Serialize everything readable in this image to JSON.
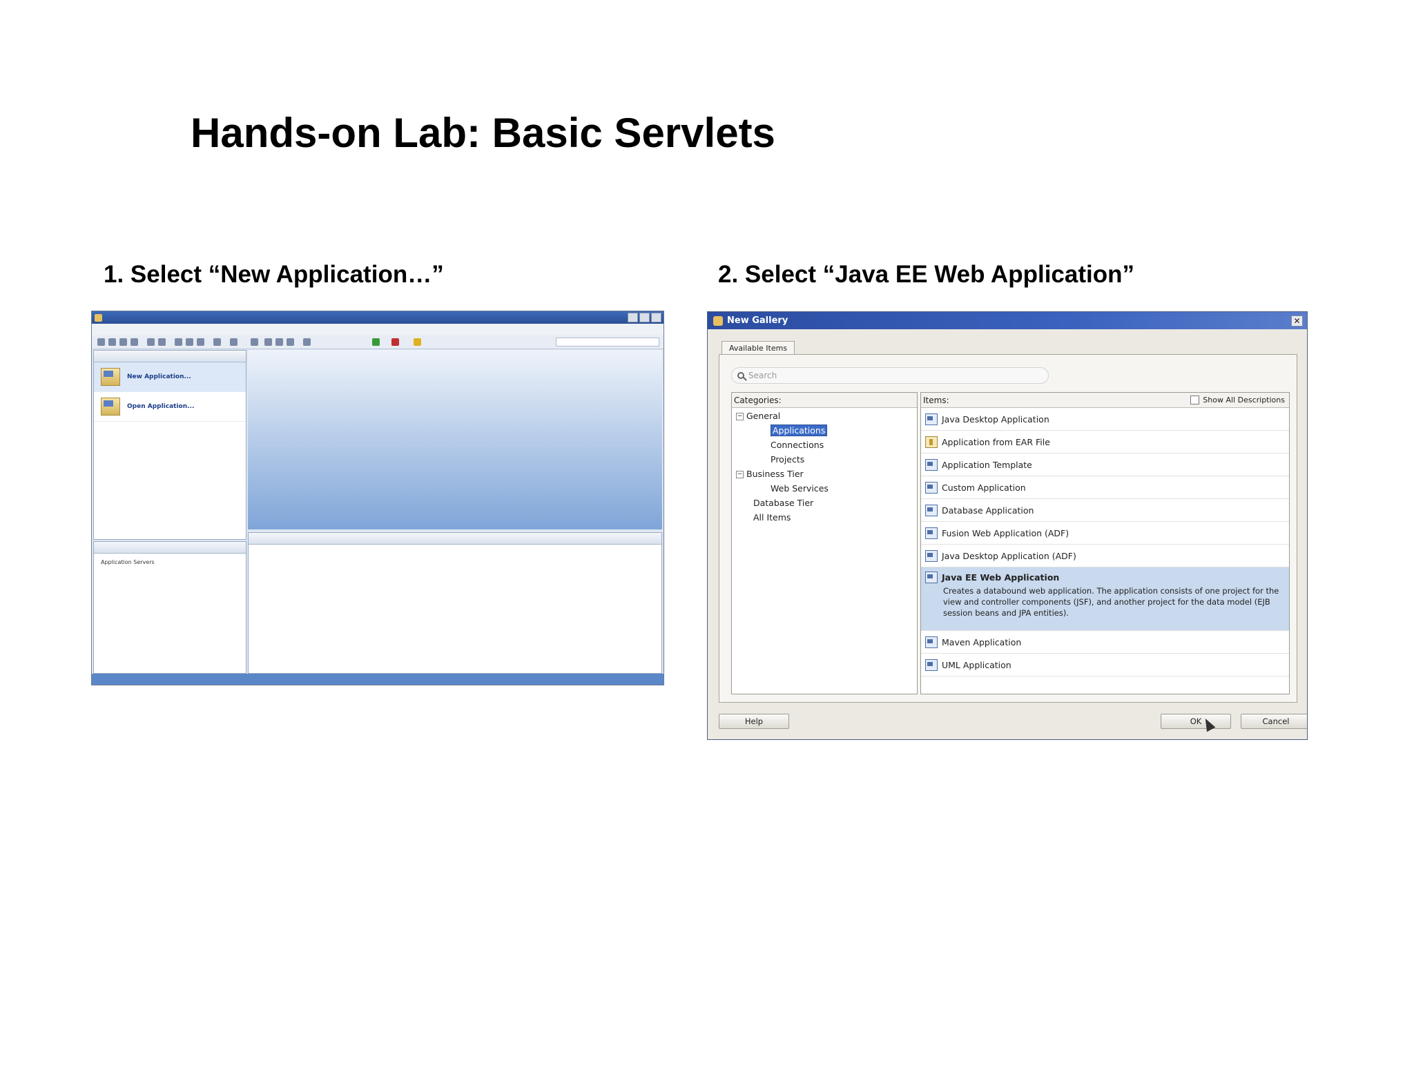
{
  "slide": {
    "title": "Hands-on Lab: Basic Servlets",
    "step1": "1. Select “New Application…”",
    "step2": "2. Select “Java EE Web Application”"
  },
  "ide": {
    "nav_items": [
      "New Application...",
      "Open Application..."
    ],
    "lower_tree": "Application Servers"
  },
  "gallery": {
    "title": "New Gallery",
    "tab": "Available Items",
    "search_placeholder": "Search",
    "categories_header": "Categories:",
    "items_header": "Items:",
    "show_all": "Show All Descriptions",
    "categories": [
      {
        "label": "General",
        "level": 0,
        "expander": "−"
      },
      {
        "label": "Applications",
        "level": 2,
        "selected": true
      },
      {
        "label": "Connections",
        "level": 2
      },
      {
        "label": "Projects",
        "level": 2
      },
      {
        "label": "Business Tier",
        "level": 0,
        "expander": "−"
      },
      {
        "label": "Web Services",
        "level": 2
      },
      {
        "label": "Database Tier",
        "level": 1
      },
      {
        "label": "All Items",
        "level": 1
      }
    ],
    "items": [
      {
        "label": "Java Desktop Application",
        "icon": "app-icon"
      },
      {
        "label": "Application from EAR File",
        "icon": "ear-file-icon"
      },
      {
        "label": "Application Template",
        "icon": "template-icon"
      },
      {
        "label": "Custom Application",
        "icon": "app-icon"
      },
      {
        "label": "Database Application",
        "icon": "app-icon"
      },
      {
        "label": "Fusion Web Application (ADF)",
        "icon": "app-icon"
      },
      {
        "label": "Java Desktop Application (ADF)",
        "icon": "app-icon"
      },
      {
        "label": "Java EE Web Application",
        "icon": "app-icon",
        "selected": true,
        "description": "Creates a databound web application. The application consists of one project for the view and controller components (JSF), and another project for the data model (EJB session beans and JPA entities)."
      },
      {
        "label": "Maven Application",
        "icon": "app-icon"
      },
      {
        "label": "UML Application",
        "icon": "app-icon"
      }
    ],
    "buttons": {
      "help": "Help",
      "ok": "OK",
      "cancel": "Cancel"
    }
  }
}
